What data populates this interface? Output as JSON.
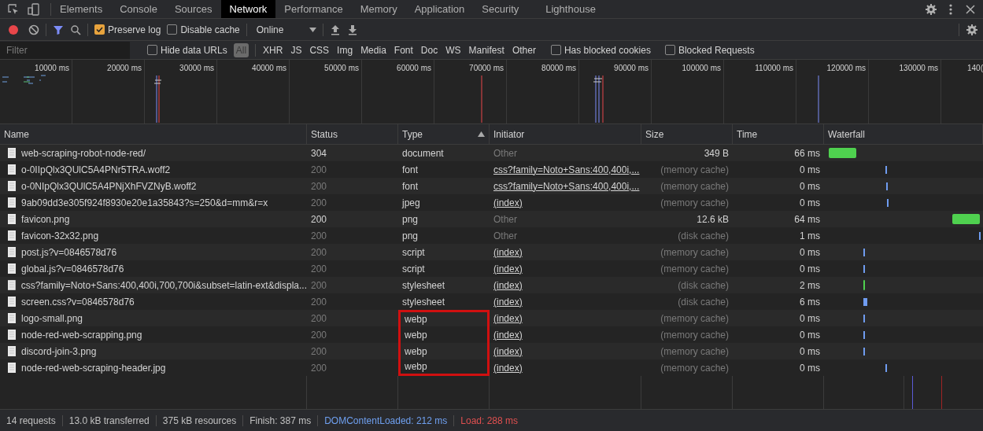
{
  "tabs": [
    {
      "label": "Elements",
      "selected": false
    },
    {
      "label": "Console",
      "selected": false
    },
    {
      "label": "Sources",
      "selected": false
    },
    {
      "label": "Network",
      "selected": true
    },
    {
      "label": "Performance",
      "selected": false
    },
    {
      "label": "Memory",
      "selected": false
    },
    {
      "label": "Application",
      "selected": false
    },
    {
      "label": "Security",
      "selected": false
    },
    {
      "label": "Lighthouse",
      "selected": false
    }
  ],
  "toolbar": {
    "recording": true,
    "preserve_log": {
      "label": "Preserve log",
      "checked": true
    },
    "disable_cache": {
      "label": "Disable cache",
      "checked": false
    },
    "throttling": "Online"
  },
  "filter_bar": {
    "placeholder": "Filter",
    "hide_data_urls": {
      "label": "Hide data URLs",
      "checked": false
    },
    "types": [
      {
        "label": "All",
        "selected": true
      },
      {
        "label": "XHR",
        "selected": false
      },
      {
        "label": "JS",
        "selected": false
      },
      {
        "label": "CSS",
        "selected": false
      },
      {
        "label": "Img",
        "selected": false
      },
      {
        "label": "Media",
        "selected": false
      },
      {
        "label": "Font",
        "selected": false
      },
      {
        "label": "Doc",
        "selected": false
      },
      {
        "label": "WS",
        "selected": false
      },
      {
        "label": "Manifest",
        "selected": false
      },
      {
        "label": "Other",
        "selected": false
      }
    ],
    "has_blocked_cookies": {
      "label": "Has blocked cookies",
      "checked": false
    },
    "blocked_requests": {
      "label": "Blocked Requests",
      "checked": false
    }
  },
  "overview": {
    "ticks": [
      "10000 ms",
      "20000 ms",
      "30000 ms",
      "40000 ms",
      "50000 ms",
      "60000 ms",
      "70000 ms",
      "80000 ms",
      "90000 ms",
      "100000 ms",
      "110000 ms",
      "120000 ms",
      "130000 ms",
      "140("
    ]
  },
  "table": {
    "columns": [
      {
        "label": "Name",
        "sorted": false
      },
      {
        "label": "Status",
        "sorted": false
      },
      {
        "label": "Type",
        "sorted": true
      },
      {
        "label": "Initiator",
        "sorted": false
      },
      {
        "label": "Size",
        "sorted": false
      },
      {
        "label": "Time",
        "sorted": false
      },
      {
        "label": "Waterfall",
        "sorted": false
      }
    ],
    "rows": [
      {
        "name": "web-scraping-robot-node-red/",
        "status": "304",
        "type": "document",
        "initiator": "Other",
        "initiator_link": false,
        "size": "349 B",
        "cached": false,
        "time": "66 ms",
        "highlighted": false
      },
      {
        "name": "o-0IIpQlx3QUlC5A4PNr5TRA.woff2",
        "status": "200",
        "type": "font",
        "initiator": "css?family=Noto+Sans:400,400i,...",
        "initiator_link": true,
        "size": "(memory cache)",
        "cached": true,
        "time": "0 ms",
        "highlighted": false
      },
      {
        "name": "o-0NIpQlx3QUlC5A4PNjXhFVZNyB.woff2",
        "status": "200",
        "type": "font",
        "initiator": "css?family=Noto+Sans:400,400i,...",
        "initiator_link": true,
        "size": "(memory cache)",
        "cached": true,
        "time": "0 ms",
        "highlighted": false
      },
      {
        "name": "9ab09dd3e305f924f8930e20e1a35843?s=250&d=mm&r=x",
        "status": "200",
        "type": "jpeg",
        "initiator": "(index)",
        "initiator_link": true,
        "size": "(memory cache)",
        "cached": true,
        "time": "0 ms",
        "highlighted": false
      },
      {
        "name": "favicon.png",
        "status": "200",
        "type": "png",
        "initiator": "Other",
        "initiator_link": false,
        "size": "12.6 kB",
        "cached": false,
        "time": "64 ms",
        "highlighted": false
      },
      {
        "name": "favicon-32x32.png",
        "status": "200",
        "type": "png",
        "initiator": "Other",
        "initiator_link": false,
        "size": "(disk cache)",
        "cached": true,
        "time": "1 ms",
        "highlighted": false
      },
      {
        "name": "post.js?v=0846578d76",
        "status": "200",
        "type": "script",
        "initiator": "(index)",
        "initiator_link": true,
        "size": "(memory cache)",
        "cached": true,
        "time": "0 ms",
        "highlighted": false
      },
      {
        "name": "global.js?v=0846578d76",
        "status": "200",
        "type": "script",
        "initiator": "(index)",
        "initiator_link": true,
        "size": "(memory cache)",
        "cached": true,
        "time": "0 ms",
        "highlighted": false
      },
      {
        "name": "css?family=Noto+Sans:400,400i,700,700i&subset=latin-ext&displa...",
        "status": "200",
        "type": "stylesheet",
        "initiator": "(index)",
        "initiator_link": true,
        "size": "(disk cache)",
        "cached": true,
        "time": "2 ms",
        "highlighted": false
      },
      {
        "name": "screen.css?v=0846578d76",
        "status": "200",
        "type": "stylesheet",
        "initiator": "(index)",
        "initiator_link": true,
        "size": "(disk cache)",
        "cached": true,
        "time": "6 ms",
        "highlighted": false
      },
      {
        "name": "logo-small.png",
        "status": "200",
        "type": "webp",
        "initiator": "(index)",
        "initiator_link": true,
        "size": "(memory cache)",
        "cached": true,
        "time": "0 ms",
        "highlighted": true
      },
      {
        "name": "node-red-web-scrapping.png",
        "status": "200",
        "type": "webp",
        "initiator": "(index)",
        "initiator_link": true,
        "size": "(memory cache)",
        "cached": true,
        "time": "0 ms",
        "highlighted": true
      },
      {
        "name": "discord-join-3.png",
        "status": "200",
        "type": "webp",
        "initiator": "(index)",
        "initiator_link": true,
        "size": "(memory cache)",
        "cached": true,
        "time": "0 ms",
        "highlighted": true
      },
      {
        "name": "node-red-web-scraping-header.jpg",
        "status": "200",
        "type": "webp",
        "initiator": "(index)",
        "initiator_link": true,
        "size": "(memory cache)",
        "cached": true,
        "time": "0 ms",
        "highlighted": true
      }
    ]
  },
  "status_bar": [
    {
      "text": "14 requests",
      "kind": "plain"
    },
    {
      "text": "13.0 kB transferred",
      "kind": "plain"
    },
    {
      "text": "375 kB resources",
      "kind": "plain"
    },
    {
      "text": "Finish: 387 ms",
      "kind": "plain"
    },
    {
      "text": "DOMContentLoaded: 212 ms",
      "kind": "dcl"
    },
    {
      "text": "Load: 288 ms",
      "kind": "load"
    }
  ]
}
